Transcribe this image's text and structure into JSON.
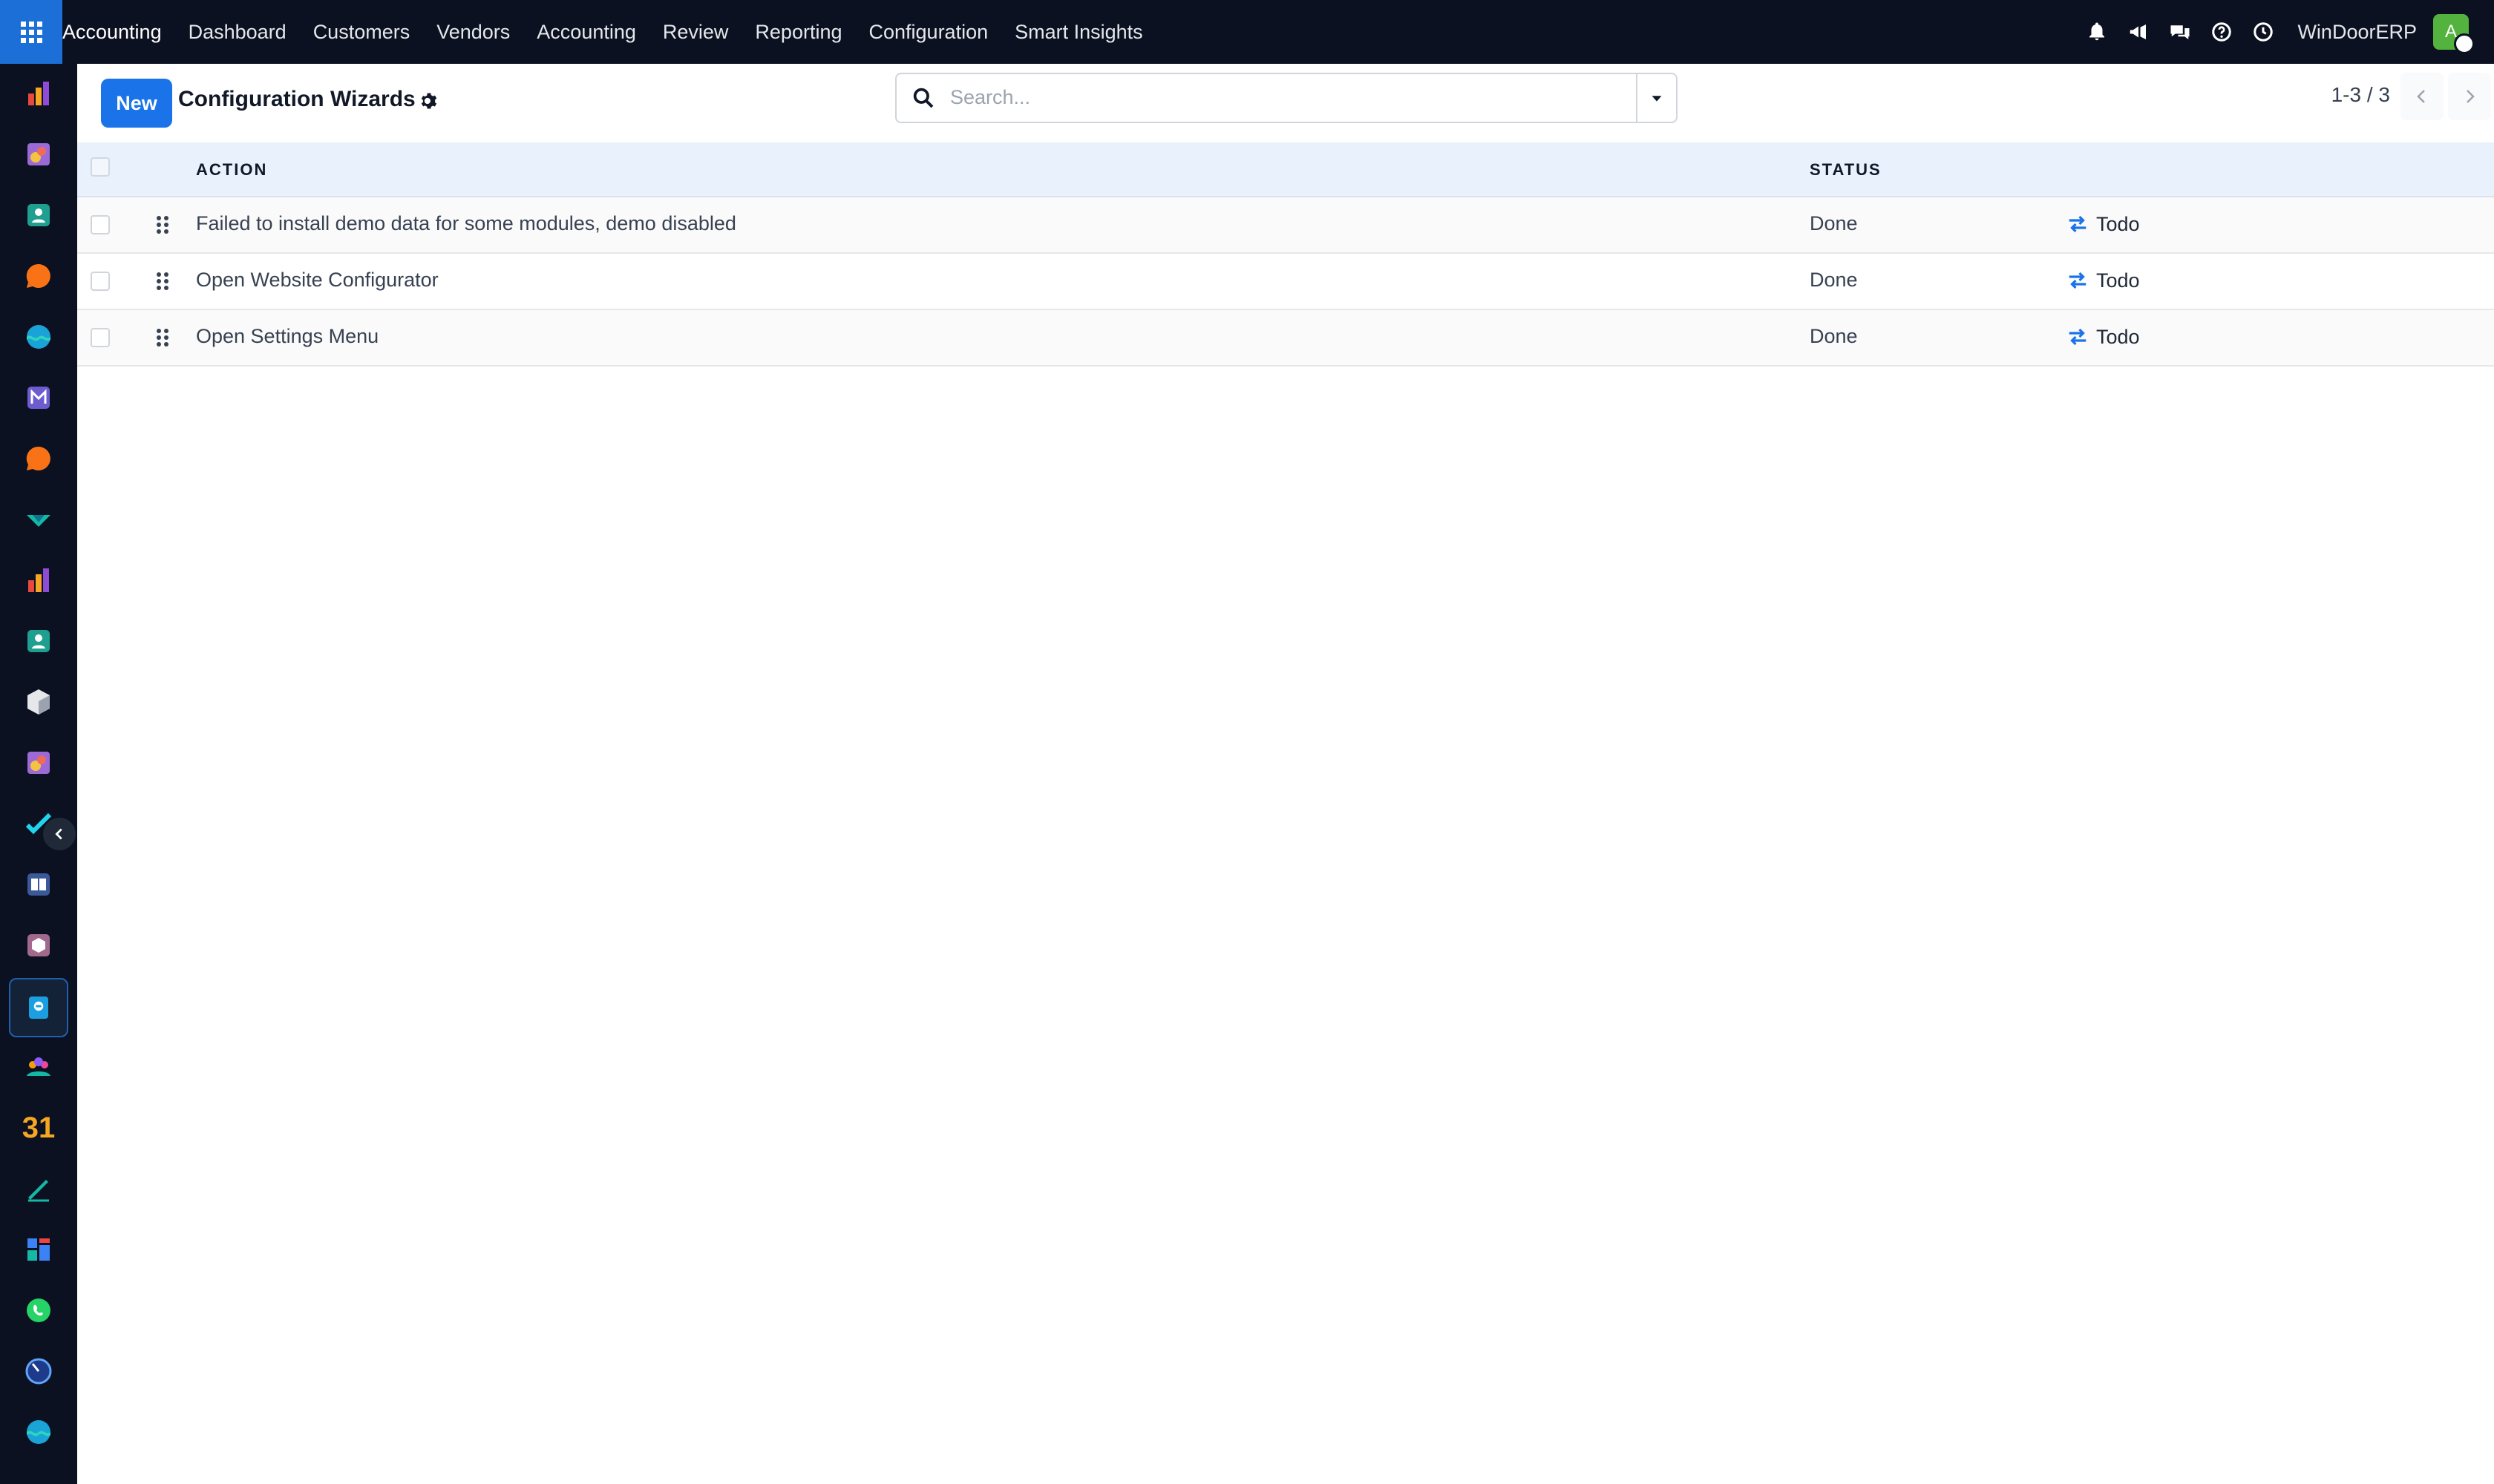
{
  "navbar": {
    "menu": [
      "Accounting",
      "Dashboard",
      "Customers",
      "Vendors",
      "Accounting",
      "Review",
      "Reporting",
      "Configuration",
      "Smart Insights"
    ],
    "company": "WinDoorERP",
    "avatar_initial": "A",
    "tray_icons": [
      "bell-icon",
      "megaphone-icon",
      "chat-icon",
      "help-icon",
      "clock-icon"
    ]
  },
  "sidebar": {
    "apps": [
      "bar-chart-app",
      "stickers-app",
      "contacts-app",
      "discuss-app",
      "wave-app",
      "mail-app",
      "livechat-app",
      "check-app",
      "bar-chart-app-2",
      "contacts-app-2",
      "cube-app",
      "stickers-app-2",
      "task-app",
      "book-app",
      "package-app",
      "invoice-app",
      "team-app",
      "calendar-app",
      "sign-app",
      "dashboard-app",
      "whatsapp-app",
      "timer-app",
      "wave-app-2"
    ],
    "calendar_label": "31",
    "active_index": 15
  },
  "control_panel": {
    "new_label": "New",
    "title": "Configuration Wizards",
    "search_placeholder": "Search...",
    "pager": "1-3 / 3"
  },
  "table": {
    "columns": [
      "ACTION",
      "STATUS"
    ],
    "rows": [
      {
        "action": "Failed to install demo data for some modules, demo disabled",
        "status": "Done",
        "button": "Todo"
      },
      {
        "action": "Open Website Configurator",
        "status": "Done",
        "button": "Todo"
      },
      {
        "action": "Open Settings Menu",
        "status": "Done",
        "button": "Todo"
      }
    ]
  },
  "colors": {
    "navbar_bg": "#0b1120",
    "primary": "#1a73e8",
    "header_bg": "#e8f1fc",
    "avatar": "#54b33f"
  }
}
